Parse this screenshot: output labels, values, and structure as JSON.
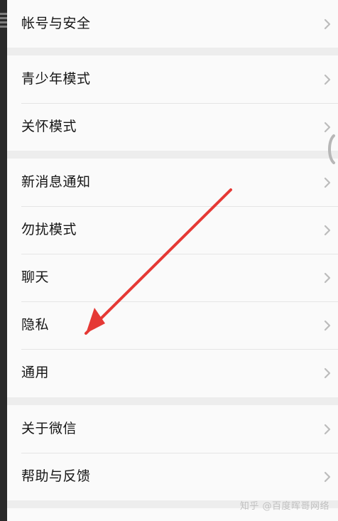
{
  "settings": {
    "account_security": "帐号与安全",
    "teen_mode": "青少年模式",
    "care_mode": "关怀模式",
    "new_message_notification": "新消息通知",
    "do_not_disturb": "勿扰模式",
    "chat": "聊天",
    "privacy": "隐私",
    "general": "通用",
    "about_wechat": "关于微信",
    "help_feedback": "帮助与反馈"
  },
  "icons": {
    "row_arrow": "chevron-right-icon",
    "annotation": "red-arrow-icon"
  },
  "colors": {
    "annotation_arrow": "#e53935",
    "background": "#ededed",
    "row_background": "#fafafa"
  },
  "watermark": "知乎 @百度晖哥网络"
}
